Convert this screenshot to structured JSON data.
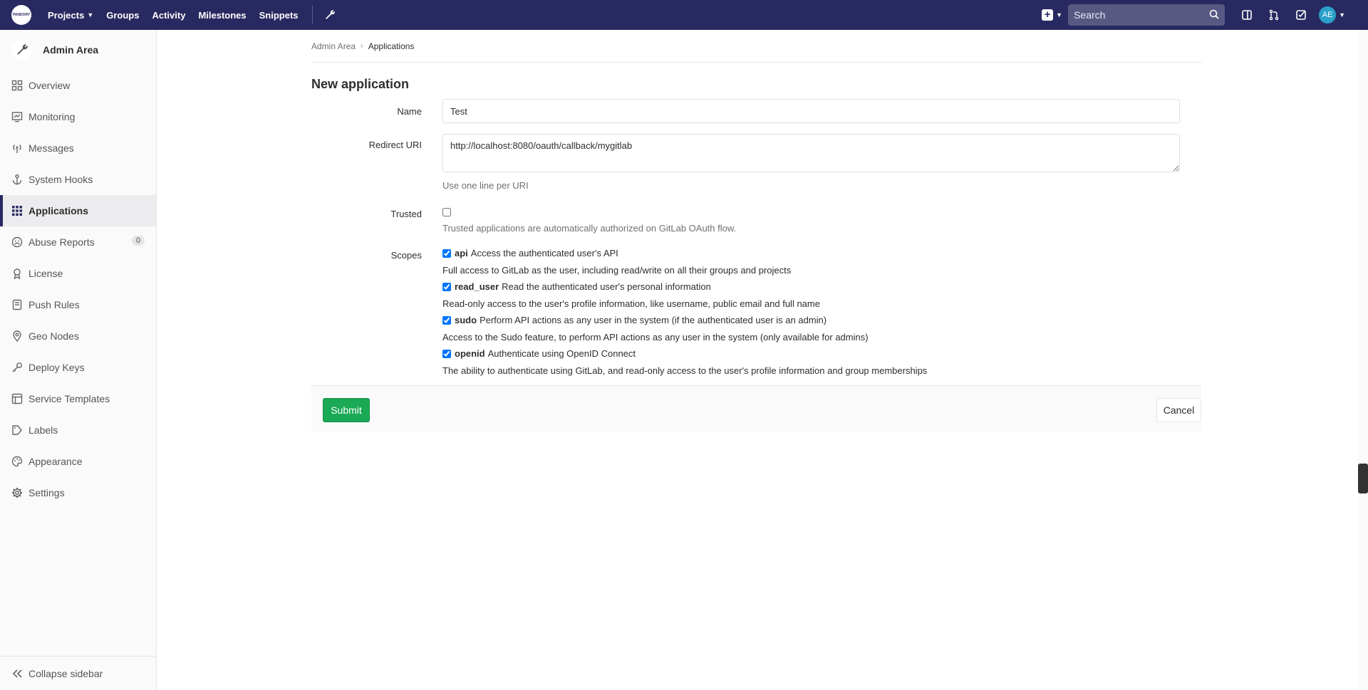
{
  "navbar": {
    "logo_text": "PANDORY",
    "links": [
      {
        "label": "Projects"
      },
      {
        "label": "Groups"
      },
      {
        "label": "Activity"
      },
      {
        "label": "Milestones"
      },
      {
        "label": "Snippets"
      }
    ],
    "search_placeholder": "Search",
    "avatar_initials": "AE",
    "accent": "#292961"
  },
  "sidebar": {
    "title": "Admin Area",
    "items": [
      {
        "label": "Overview",
        "icon": "overview-icon"
      },
      {
        "label": "Monitoring",
        "icon": "monitoring-icon"
      },
      {
        "label": "Messages",
        "icon": "messages-icon"
      },
      {
        "label": "System Hooks",
        "icon": "hook-icon"
      },
      {
        "label": "Applications",
        "icon": "applications-icon",
        "active": true
      },
      {
        "label": "Abuse Reports",
        "icon": "abuse-icon",
        "badge": "0"
      },
      {
        "label": "License",
        "icon": "license-icon"
      },
      {
        "label": "Push Rules",
        "icon": "push-rules-icon"
      },
      {
        "label": "Geo Nodes",
        "icon": "geo-icon"
      },
      {
        "label": "Deploy Keys",
        "icon": "key-icon"
      },
      {
        "label": "Service Templates",
        "icon": "templates-icon"
      },
      {
        "label": "Labels",
        "icon": "labels-icon"
      },
      {
        "label": "Appearance",
        "icon": "appearance-icon"
      },
      {
        "label": "Settings",
        "icon": "settings-icon"
      }
    ],
    "collapse_label": "Collapse sidebar"
  },
  "breadcrumb": {
    "parent": "Admin Area",
    "current": "Applications"
  },
  "page": {
    "title": "New application"
  },
  "form": {
    "name_label": "Name",
    "name_value": "Test",
    "redirect_label": "Redirect URI",
    "redirect_value": "http://localhost:8080/oauth/callback/mygitlab",
    "redirect_help": "Use one line per URI",
    "trusted_label": "Trusted",
    "trusted_help": "Trusted applications are automatically authorized on GitLab OAuth flow.",
    "scopes_label": "Scopes",
    "scopes": [
      {
        "name": "api",
        "summary": "Access the authenticated user's API",
        "description": "Full access to GitLab as the user, including read/write on all their groups and projects"
      },
      {
        "name": "read_user",
        "summary": "Read the authenticated user's personal information",
        "description": "Read-only access to the user's profile information, like username, public email and full name"
      },
      {
        "name": "sudo",
        "summary": "Perform API actions as any user in the system (if the authenticated user is an admin)",
        "description": "Access to the Sudo feature, to perform API actions as any user in the system (only available for admins)"
      },
      {
        "name": "openid",
        "summary": "Authenticate using OpenID Connect",
        "description": "The ability to authenticate using GitLab, and read-only access to the user's profile information and group memberships"
      }
    ],
    "submit_label": "Submit",
    "cancel_label": "Cancel"
  }
}
